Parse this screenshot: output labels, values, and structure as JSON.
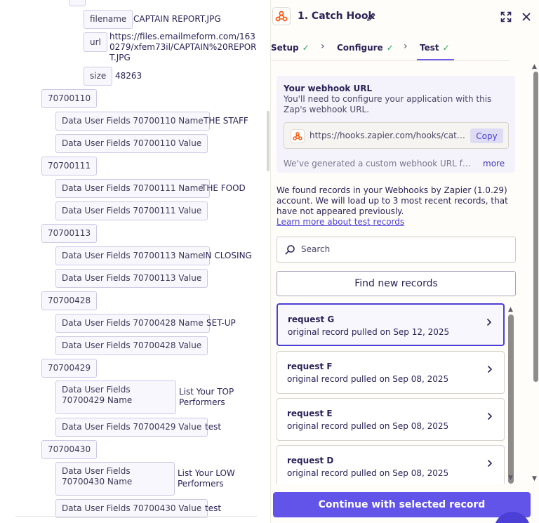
{
  "left": {
    "file": {
      "filename_key": "filename",
      "filename_value": "CAPTAIN REPORT.JPG",
      "url_key": "url",
      "url_value": "https://files.emailmeform.com/1630279/xfem73il/CAPTAIN%20REPORT.JPG",
      "size_key": "size",
      "size_value": "48263"
    },
    "groups": [
      {
        "id": "70700110",
        "name_key": "Data User Fields 70700110 Name",
        "name_value": "THE STAFF",
        "value_key": "Data User Fields 70700110 Value",
        "value_value": ""
      },
      {
        "id": "70700111",
        "name_key": "Data User Fields 70700111 Name",
        "name_value": "THE FOOD",
        "value_key": "Data User Fields 70700111 Value",
        "value_value": ""
      },
      {
        "id": "70700113",
        "name_key": "Data User Fields 70700113 Name",
        "name_value": "IN CLOSING",
        "value_key": "Data User Fields 70700113 Value",
        "value_value": ""
      },
      {
        "id": "70700428",
        "name_key": "Data User Fields 70700428 Name",
        "name_value": "SET-UP",
        "value_key": "Data User Fields 70700428 Value",
        "value_value": ""
      },
      {
        "id": "70700429",
        "name_key": "Data User Fields 70700429 Name",
        "name_value": "List Your TOP Performers",
        "value_key": "Data User Fields 70700429 Value",
        "value_value": "test"
      },
      {
        "id": "70700430",
        "name_key": "Data User Fields 70700430 Name",
        "name_value": "List Your LOW Performers",
        "value_key": "Data User Fields 70700430 Value",
        "value_value": "test"
      }
    ]
  },
  "header": {
    "step_title": "1. Catch Hook",
    "tabs": [
      {
        "label": "Setup"
      },
      {
        "label": "Configure"
      },
      {
        "label": "Test"
      }
    ],
    "active_tab": "Test"
  },
  "webhook": {
    "title": "Your webhook URL",
    "description": "You'll need to configure your application with this Zap's webhook URL.",
    "url": "https://hooks.zapier.com/hooks/catch/",
    "copy_label": "Copy",
    "generated_text": "We've generated a custom webhook URL for you",
    "more_label": "more"
  },
  "records_info": {
    "text": "We found records in your Webhooks by Zapier (1.0.29) account. We will load up to 3 most recent records, that have not appeared previously.",
    "learn_link": "Learn more about test records"
  },
  "search": {
    "placeholder": "Search",
    "value": ""
  },
  "find_button": "Find new records",
  "records": [
    {
      "title": "request G",
      "subtitle": "original record pulled on Sep 12, 2025",
      "selected": true
    },
    {
      "title": "request F",
      "subtitle": "original record pulled on Sep 08, 2025",
      "selected": false
    },
    {
      "title": "request E",
      "subtitle": "original record pulled on Sep 08, 2025",
      "selected": false
    },
    {
      "title": "request D",
      "subtitle": "original record pulled on Sep 08, 2025",
      "selected": false
    }
  ],
  "continue_button": "Continue with selected record",
  "colors": {
    "accent": "#6254e8",
    "check": "#26a35a",
    "link": "#4b3fd6"
  },
  "icons": [
    "zapier-webhook-icon",
    "pencil-icon",
    "expand-icon",
    "close-icon",
    "check-icon",
    "chevron-right-icon",
    "search-icon",
    "help-chat-icon"
  ]
}
